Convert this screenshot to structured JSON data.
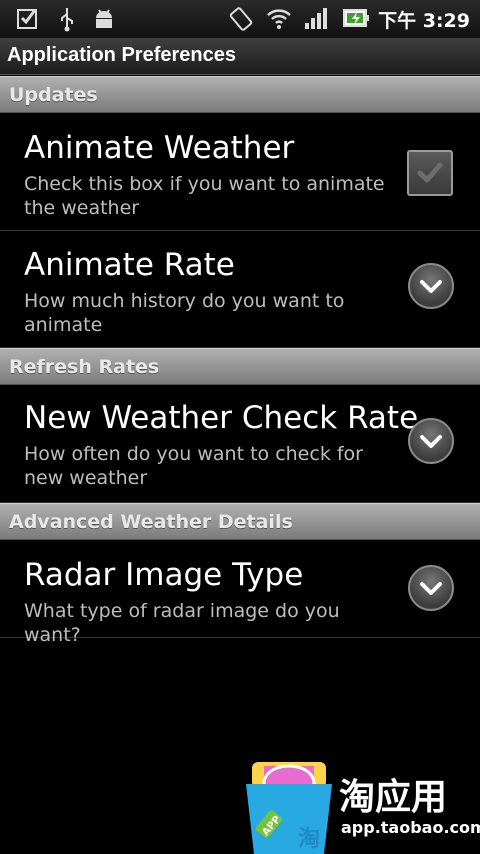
{
  "status_bar": {
    "time": "下午 3:29",
    "icons": [
      "task-check-icon",
      "usb-icon",
      "android-debug-icon",
      "auto-rotate-icon",
      "wifi-icon",
      "signal-icon",
      "battery-charging-icon"
    ]
  },
  "screen_title": "Application Preferences",
  "sections": [
    {
      "header": "Updates",
      "items": [
        {
          "title": "Animate Weather",
          "summary": "Check this box if you want to animate the weather",
          "control": "checkbox",
          "checked": false
        },
        {
          "title": "Animate Rate",
          "summary": "How much history do you want to animate",
          "control": "dropdown"
        }
      ]
    },
    {
      "header": "Refresh Rates",
      "items": [
        {
          "title": "New Weather Check Rate",
          "summary": "How often do you want to check for new weather",
          "control": "dropdown"
        }
      ]
    },
    {
      "header": "Advanced Weather Details",
      "items": [
        {
          "title": "Radar Image Type",
          "summary": "What type of radar image do you want?",
          "control": "dropdown"
        }
      ]
    }
  ],
  "watermark": {
    "brand": "淘应用",
    "url": "app.taobao.com",
    "badge_text": "APP",
    "tag_text": "淘"
  }
}
